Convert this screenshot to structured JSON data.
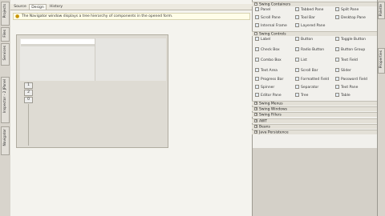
{
  "left_dock": {
    "tabs": [
      {
        "label": "Projects"
      },
      {
        "label": "Files"
      },
      {
        "label": "Services"
      },
      {
        "label": "Inspector - 2 JPanel"
      },
      {
        "label": "Navigator"
      }
    ]
  },
  "editor": {
    "tabs": [
      {
        "label": "Source"
      },
      {
        "label": "Design"
      },
      {
        "label": "History"
      }
    ],
    "hint_text": "The Navigator window displays a tree hierarchy of components in the opened form.",
    "handles": [
      {
        "label": "1"
      },
      {
        "label": "2"
      },
      {
        "label": "0"
      }
    ]
  },
  "palette": {
    "categories": [
      {
        "label": "Swing Containers",
        "sign": "−"
      },
      {
        "label": "Swing Controls",
        "sign": "−"
      },
      {
        "label": "Swing Menus",
        "sign": "+"
      },
      {
        "label": "Swing Windows",
        "sign": "+"
      },
      {
        "label": "Swing Fillers",
        "sign": "+"
      },
      {
        "label": "AWT",
        "sign": "+"
      },
      {
        "label": "Beans",
        "sign": "+"
      },
      {
        "label": "Java Persistence",
        "sign": "+"
      }
    ],
    "containers": [
      {
        "label": "Panel"
      },
      {
        "label": "Tabbed Pane"
      },
      {
        "label": "Split Pane"
      },
      {
        "label": "Scroll Pane"
      },
      {
        "label": "Tool Bar"
      },
      {
        "label": "Desktop Pane"
      },
      {
        "label": "Internal Frame"
      },
      {
        "label": "Layered Pane"
      }
    ],
    "controls": [
      {
        "label": "Label"
      },
      {
        "label": "Button"
      },
      {
        "label": "Toggle Button"
      },
      {
        "label": "Check Box"
      },
      {
        "label": "Radio Button"
      },
      {
        "label": "Button Group"
      },
      {
        "label": "Combo Box"
      },
      {
        "label": "List"
      },
      {
        "label": "Text Field"
      },
      {
        "label": "Text Area"
      },
      {
        "label": "Scroll Bar"
      },
      {
        "label": "Slider"
      },
      {
        "label": "Progress Bar"
      },
      {
        "label": "Formatted Field"
      },
      {
        "label": "Password Field"
      },
      {
        "label": "Spinner"
      },
      {
        "label": "Separator"
      },
      {
        "label": "Text Pane"
      },
      {
        "label": "Editor Pane"
      },
      {
        "label": "Tree"
      },
      {
        "label": "Table"
      }
    ]
  },
  "right_dock": {
    "tabs": [
      {
        "label": "Palette"
      },
      {
        "label": "Properties"
      }
    ]
  }
}
